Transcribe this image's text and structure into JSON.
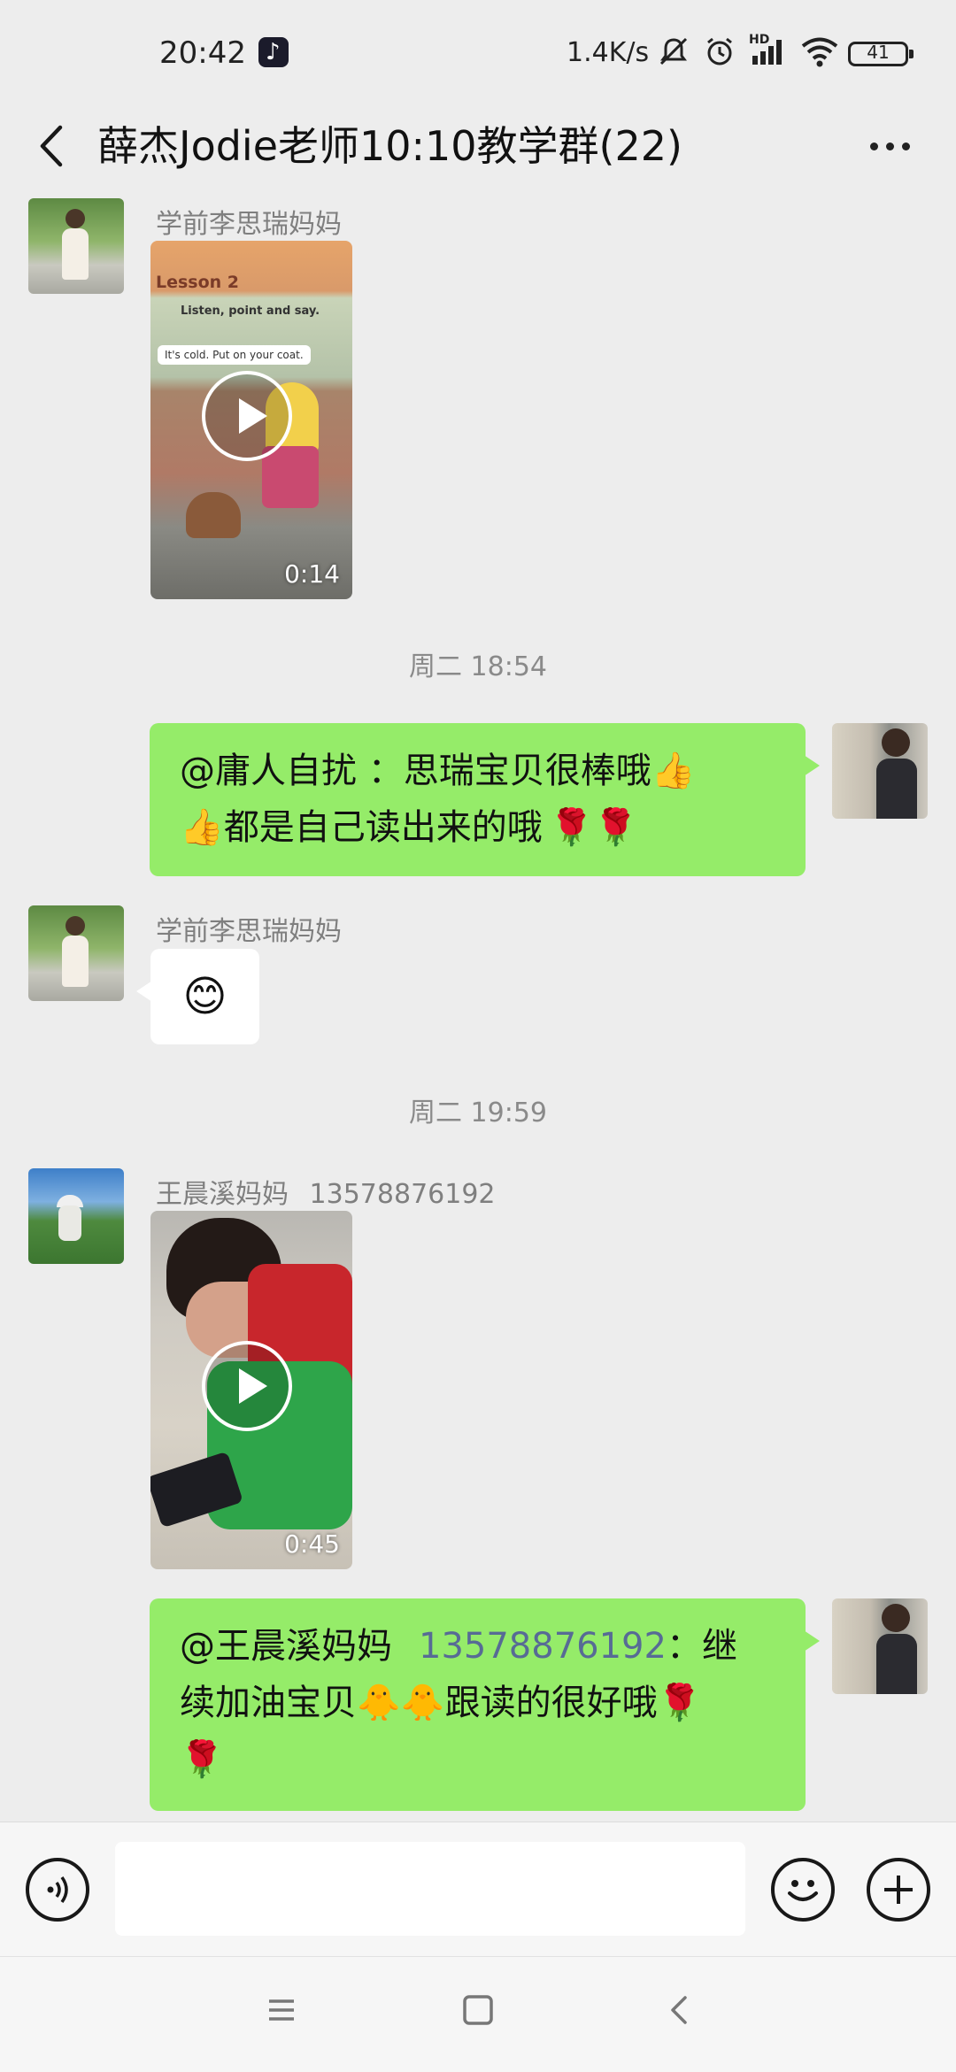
{
  "status_bar": {
    "time": "20:42",
    "network_speed": "1.4K/s",
    "hd_label": "HD",
    "battery": "41",
    "icons": [
      "tiktok-icon",
      "mute-icon",
      "alarm-icon",
      "signal-icon",
      "wifi-icon",
      "battery-icon"
    ]
  },
  "header": {
    "title": "薛杰Jodie老师10:10教学群(22)"
  },
  "messages": [
    {
      "sender": "学前李思瑞妈妈",
      "type": "video",
      "duration": "0:14",
      "video_caption": "Lesson 2",
      "video_subtitle": "Listen, point and say.",
      "video_speech": "It's cold. Put on your coat."
    },
    {
      "type": "time",
      "text": "周二 18:54"
    },
    {
      "type": "text",
      "outgoing": true,
      "line1_text": "@庸人自扰 ：思瑞宝贝很棒哦",
      "line1_emoji": "👍",
      "line2_emoji": "👍",
      "line2_text": "都是自己读出来的哦",
      "line2_end": "🌹🌹"
    },
    {
      "sender": "学前李思瑞妈妈",
      "type": "emoji",
      "emoji": "😊"
    },
    {
      "type": "time",
      "text": "周二 19:59"
    },
    {
      "sender": "王晨溪妈妈",
      "sender_phone": "13578876192",
      "type": "video",
      "duration": "0:45"
    },
    {
      "type": "text",
      "outgoing": true,
      "mention": "@王晨溪妈妈",
      "mention_num": "13578876192",
      "after_mention": "：继",
      "line2_text_a": "续加油宝贝",
      "line2_emoji": "🐥🐥",
      "line2_text_b": "跟读的很好哦",
      "line2_end": "🌹",
      "line3_end": "🌹"
    }
  ],
  "input_bar": {
    "placeholder": "",
    "icons": [
      "voice-icon",
      "emoji-icon",
      "plus-icon"
    ]
  },
  "nav_bar": {
    "icons": [
      "menu-icon",
      "home-icon",
      "back-icon"
    ]
  },
  "colors": {
    "bubble_green": "#95ec69",
    "background": "#ededed",
    "mention_blue": "#576b95"
  }
}
